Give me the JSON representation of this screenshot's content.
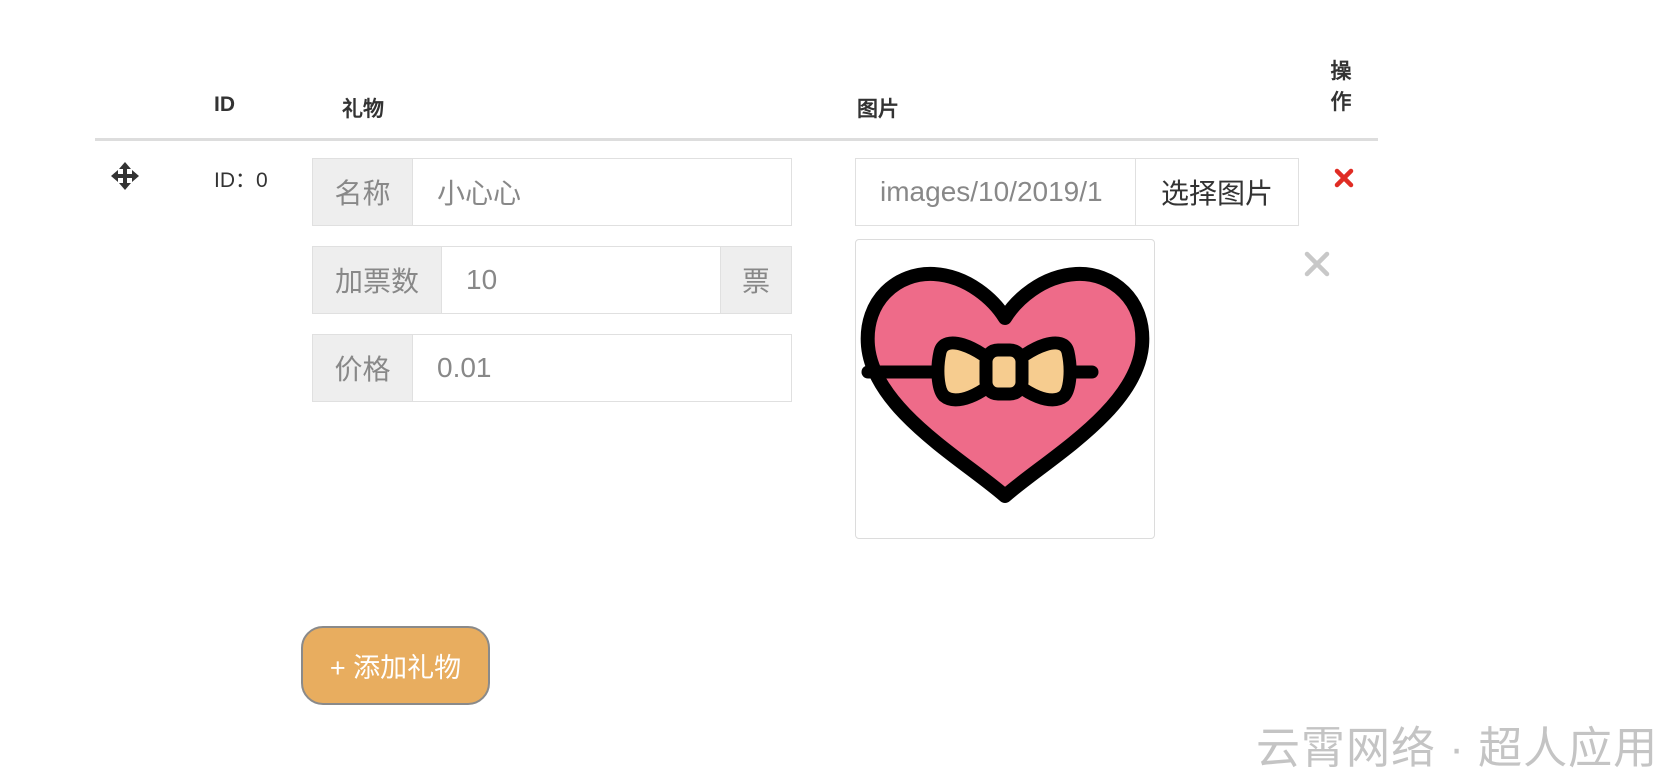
{
  "table": {
    "headers": {
      "id": "ID",
      "gift": "礼物",
      "image": "图片",
      "op_line1": "操",
      "op_line2": "作"
    },
    "row": {
      "id_text": "ID：0",
      "name_label": "名称",
      "name_value": "小心心",
      "votes_label": "加票数",
      "votes_value": "10",
      "votes_unit": "票",
      "price_label": "价格",
      "price_value": "0.01",
      "image_path": "images/10/2019/1",
      "select_image_label": "选择图片"
    }
  },
  "add_gift_label": "+ 添加礼物",
  "watermark": "云霄网络 · 超人应用",
  "colors": {
    "delete_red": "#e02c24",
    "add_button": "#e8ad5f",
    "heart_pink": "#ee6b89",
    "bow_yellow": "#f6cc8f"
  },
  "icons": {
    "drag": "move-arrows-icon",
    "delete": "red-x-icon",
    "remove_image": "gray-x-icon"
  }
}
